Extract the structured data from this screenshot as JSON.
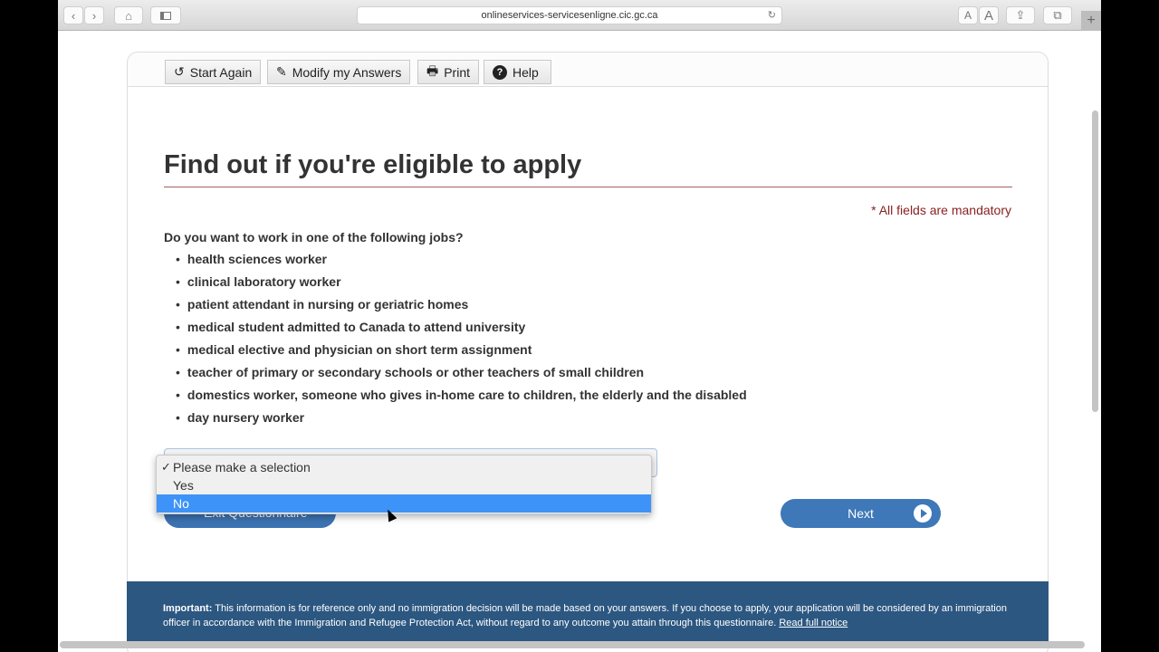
{
  "browser": {
    "url": "onlineservices-servicesenligne.cic.gc.ca",
    "back": "‹",
    "forward": "›",
    "font_small": "A",
    "font_large": "A",
    "new_tab": "+"
  },
  "toolbar": {
    "start_again": "Start Again",
    "modify": "Modify my Answers",
    "print": "Print",
    "help": "Help"
  },
  "page": {
    "title": "Find out if you're eligible to apply",
    "mandatory": "* All fields are mandatory",
    "question": "Do you want to work in one of the following jobs?",
    "jobs": [
      "health sciences worker",
      "clinical laboratory worker",
      "patient attendant in nursing or geriatric homes",
      "medical student admitted to Canada to attend university",
      "medical elective and physician on short term assignment",
      "teacher of primary or secondary schools or other teachers of small children",
      "domestics worker, someone who gives in-home care to children, the elderly and the disabled",
      "day nursery worker"
    ],
    "dropdown": {
      "options": [
        "Please make a selection",
        "Yes",
        "No"
      ],
      "checked": "Please make a selection",
      "highlighted": "No",
      "check_mark": "✓"
    },
    "exit_label": "Exit Questionnaire",
    "next_label": "Next"
  },
  "notice": {
    "bold": "Important:",
    "text": " This information is for reference only and no immigration decision will be made based on your answers. If you choose to apply, your application will be considered by an immigration officer in accordance with the Immigration and Refugee Protection Act, without regard to any outcome you attain through this questionnaire. ",
    "link": "Read full notice"
  },
  "colors": {
    "primary_button": "#3e78b8",
    "notice_bg": "#2c5781",
    "highlight": "#3d93f7",
    "mandatory": "#8b2020"
  }
}
